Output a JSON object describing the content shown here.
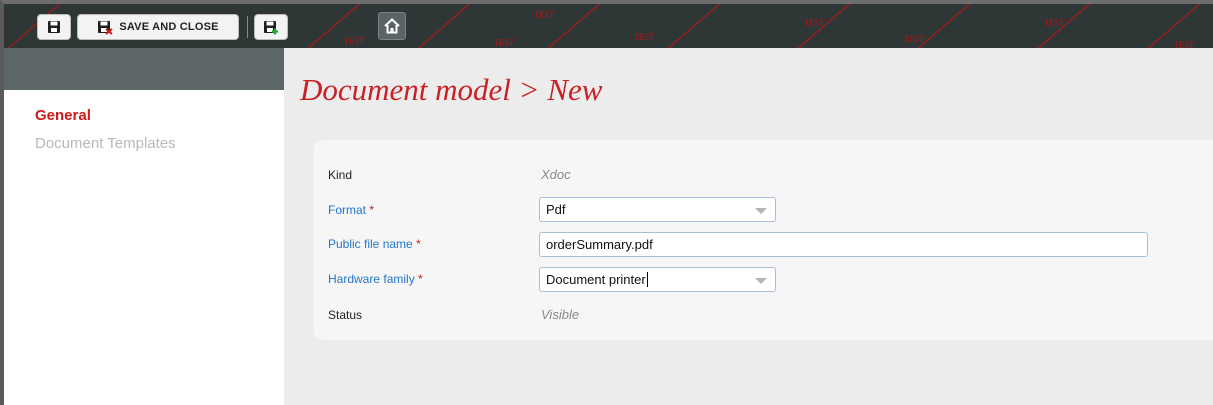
{
  "toolbar": {
    "save_and_close_label": "SAVE AND CLOSE",
    "watermark_text": "TEST",
    "background_color": "#2e3636"
  },
  "sidebar": {
    "items": [
      {
        "label": "General",
        "active": true
      },
      {
        "label": "Document Templates",
        "active": false
      }
    ]
  },
  "page": {
    "title": "Document model > New"
  },
  "form": {
    "kind": {
      "label": "Kind",
      "value": "Xdoc"
    },
    "format": {
      "label": "Format",
      "required_mark": "*",
      "value": "Pdf"
    },
    "public_file_name": {
      "label": "Public file name",
      "required_mark": "*",
      "value": "orderSummary.pdf"
    },
    "hardware_family": {
      "label": "Hardware family",
      "required_mark": "*",
      "value": "Document printer"
    },
    "status": {
      "label": "Status",
      "value": "Visible"
    }
  },
  "colors": {
    "accent_red": "#c92026",
    "link_blue": "#2377c8"
  }
}
